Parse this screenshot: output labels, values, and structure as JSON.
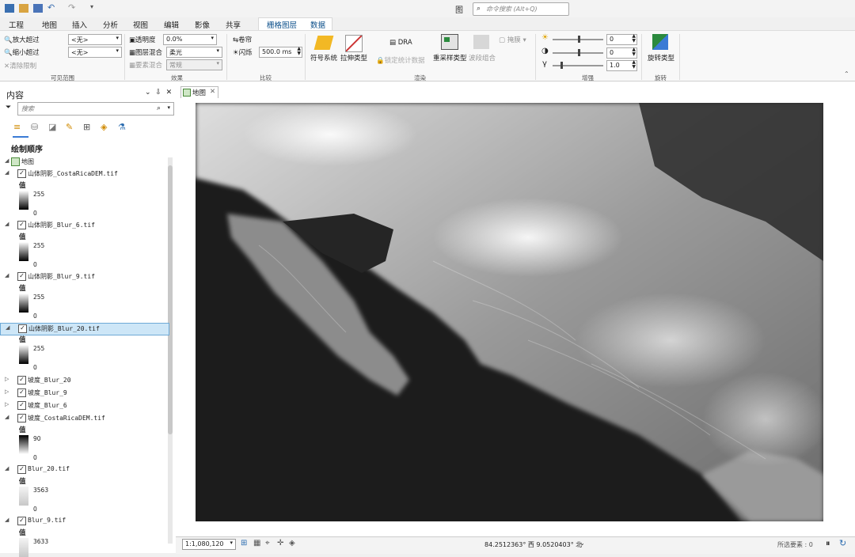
{
  "window": {
    "title": "图",
    "search_placeholder": "命令搜索 (Alt+Q)"
  },
  "tabs": [
    {
      "label": "工程"
    },
    {
      "label": "地图"
    },
    {
      "label": "插入"
    },
    {
      "label": "分析"
    },
    {
      "label": "视图"
    },
    {
      "label": "编辑"
    },
    {
      "label": "影像"
    },
    {
      "label": "共享"
    },
    {
      "label": "栅格图层"
    },
    {
      "label": "数据"
    }
  ],
  "ribbon": {
    "visible_range": {
      "zoom_in_beyond": "放大超过",
      "zoom_out_beyond": "缩小超过",
      "clear_limits": "清除限制",
      "zoom_in_value": "<无>",
      "zoom_out_value": "<无>",
      "group": "可见范围"
    },
    "effects": {
      "transparency_label": "透明度",
      "transparency_value": "0.0%",
      "layer_blend_label": "图层混合",
      "layer_blend_value": "柔光",
      "feature_blend_label": "要素混合",
      "feature_blend_value": "常规",
      "group": "效果"
    },
    "compare": {
      "swipe": "卷帘",
      "flicker_label": "闪烁",
      "flicker_value": "500.0",
      "flicker_unit": "ms",
      "group": "比较"
    },
    "rendering": {
      "symbology": "符号系统",
      "stretch_type": "拉伸类型",
      "dra": "DRA",
      "lock_stats": "锁定统计数据",
      "resampling": "重采样类型",
      "band_combo": "波段组合",
      "mask": "掩膜",
      "group": "渲染"
    },
    "enhance": {
      "brightness": "0",
      "contrast": "0",
      "gamma": "1.0",
      "group": "增强"
    },
    "rotate": {
      "label": "旋转类型",
      "group": "旋转"
    }
  },
  "contents": {
    "title": "内容",
    "search_placeholder": "搜索",
    "drawing_order": "绘制顺序",
    "map_name": "地图",
    "value_label": "值",
    "layers": [
      {
        "name": "山体阴影_CostaRicaDEM.tif",
        "max": "255",
        "min": "0",
        "ramp": "white-top"
      },
      {
        "name": "山体阴影_Blur_6.tif",
        "max": "255",
        "min": "0",
        "ramp": "white-top"
      },
      {
        "name": "山体阴影_Blur_9.tif",
        "max": "255",
        "min": "0",
        "ramp": "white-top"
      },
      {
        "name": "山体阴影_Blur_20.tif",
        "max": "255",
        "min": "0",
        "ramp": "white-top",
        "selected": true
      },
      {
        "name": "坡度_Blur_20"
      },
      {
        "name": "坡度_Blur_9"
      },
      {
        "name": "坡度_Blur_6"
      },
      {
        "name": "坡度_CostaRicaDEM.tif",
        "max": "90",
        "min": "0",
        "ramp": "black-top"
      },
      {
        "name": "Blur_20.tif",
        "max": "3563",
        "min": "0",
        "ramp": "light"
      },
      {
        "name": "Blur_9.tif",
        "max": "3633",
        "ramp": "light"
      }
    ]
  },
  "map_view": {
    "tab_label": "地图"
  },
  "status": {
    "scale": "1:1,080,120",
    "coordinates": "84.2512363° 西  9.0520403° 北",
    "selected_features": "所选要素 : 0"
  },
  "colors": {
    "accent": "#0b4f8a",
    "selection": "#cde6f7",
    "map_bg": "#111111"
  }
}
